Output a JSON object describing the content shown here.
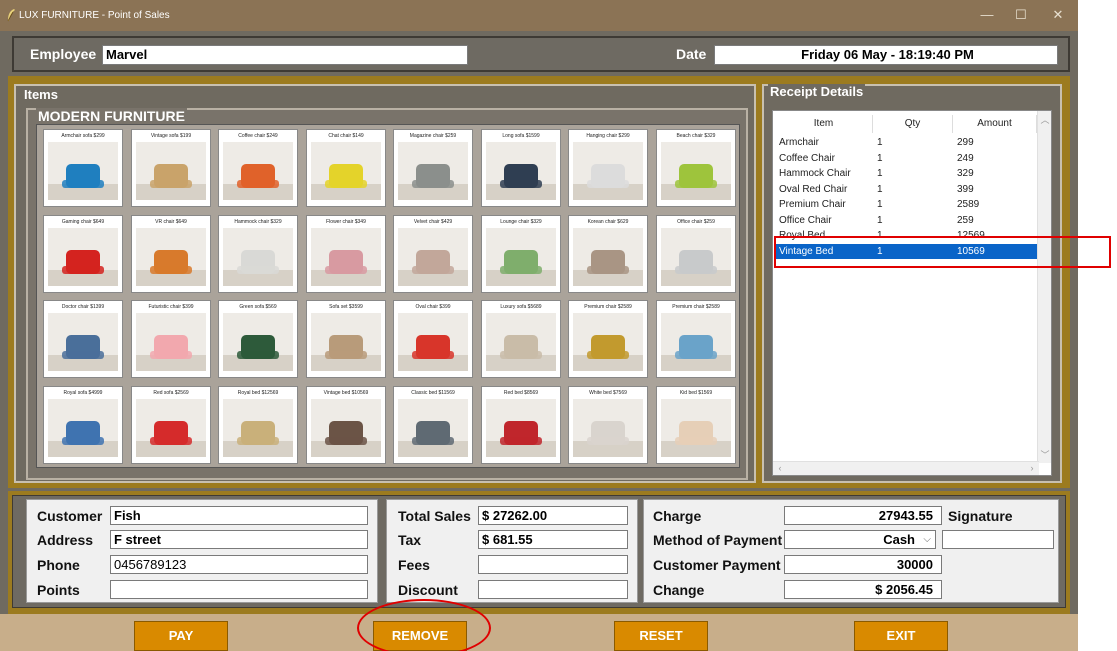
{
  "window": {
    "title": "LUX FURNITURE - Point of Sales",
    "controls": {
      "minimize": "—",
      "maximize": "☐",
      "close": "✕"
    }
  },
  "header": {
    "employee_label": "Employee",
    "employee_value": "Marvel",
    "date_label": "Date",
    "date_value": "Friday 06 May - 18:19:40 PM"
  },
  "items_panel": {
    "legend": "Items",
    "section_legend": "MODERN FURNITURE",
    "products": [
      {
        "caption": "Armchair sofa  $299",
        "color": "#1f7fbf"
      },
      {
        "caption": "Vintage sofa  $199",
        "color": "#c9a36a"
      },
      {
        "caption": "Coffee chair  $249",
        "color": "#e0622a"
      },
      {
        "caption": "Chat chair  $149",
        "color": "#e4d32a"
      },
      {
        "caption": "Magazine chair  $259",
        "color": "#8b8f8c"
      },
      {
        "caption": "Long sofa  $1599",
        "color": "#2f3e52"
      },
      {
        "caption": "Hanging chair  $299",
        "color": "#dcdcdc"
      },
      {
        "caption": "Beach chair  $329",
        "color": "#9ec43c"
      },
      {
        "caption": "Gaming chair  $649",
        "color": "#d4231f"
      },
      {
        "caption": "VR chair  $649",
        "color": "#d87a2c"
      },
      {
        "caption": "Hammock chair  $329",
        "color": "#d9d9d6"
      },
      {
        "caption": "Flower chair  $349",
        "color": "#d89aa1"
      },
      {
        "caption": "Velvet chair  $429",
        "color": "#c2a79a"
      },
      {
        "caption": "Lounge chair  $329",
        "color": "#7fae6c"
      },
      {
        "caption": "Korean chair  $629",
        "color": "#a99584"
      },
      {
        "caption": "Office chair  $259",
        "color": "#c8cacb"
      },
      {
        "caption": "Doctor chair  $1399",
        "color": "#4a6f9a"
      },
      {
        "caption": "Futuristic chair  $399",
        "color": "#f2a8ae"
      },
      {
        "caption": "Green sofa  $569",
        "color": "#2d5a3a"
      },
      {
        "caption": "Sofa set  $3599",
        "color": "#b89b7a"
      },
      {
        "caption": "Oval chair  $399",
        "color": "#d8352a"
      },
      {
        "caption": "Luxury sofa  $5689",
        "color": "#c9bca8"
      },
      {
        "caption": "Premium chair  $2589",
        "color": "#c29a2e"
      },
      {
        "caption": "Premium chair  $2589",
        "color": "#6aa3c9"
      },
      {
        "caption": "Royal sofa  $4999",
        "color": "#3f73b0"
      },
      {
        "caption": "Red sofa  $2569",
        "color": "#d52b2b"
      },
      {
        "caption": "Royal bed  $12569",
        "color": "#c9b07a"
      },
      {
        "caption": "Vintage bed  $10569",
        "color": "#6b5446"
      },
      {
        "caption": "Classic bed  $11569",
        "color": "#5f6a73"
      },
      {
        "caption": "Red bed  $8569",
        "color": "#c0262c"
      },
      {
        "caption": "White bed  $7569",
        "color": "#d9d4ce"
      },
      {
        "caption": "Kid bed  $1569",
        "color": "#e6cfb7"
      }
    ]
  },
  "receipt": {
    "legend": "Receipt Details",
    "columns": [
      "Item",
      "Qty",
      "Amount"
    ],
    "rows": [
      {
        "item": "Armchair",
        "qty": "1",
        "amount": "299"
      },
      {
        "item": "Coffee Chair",
        "qty": "1",
        "amount": "249"
      },
      {
        "item": "Hammock Chair",
        "qty": "1",
        "amount": "329"
      },
      {
        "item": "Oval Red Chair",
        "qty": "1",
        "amount": "399"
      },
      {
        "item": "Premium Chair",
        "qty": "1",
        "amount": "2589"
      },
      {
        "item": "Office Chair",
        "qty": "1",
        "amount": "259"
      },
      {
        "item": "Royal Bed",
        "qty": "1",
        "amount": "12569"
      },
      {
        "item": "Vintage Bed",
        "qty": "1",
        "amount": "10569"
      }
    ],
    "selected_row": "Vintage Bed"
  },
  "customer": {
    "customer_label": "Customer",
    "customer_value": "Fish",
    "address_label": "Address",
    "address_value": "F street",
    "phone_label": "Phone",
    "phone_value": "0456789123",
    "points_label": "Points",
    "points_value": ""
  },
  "totals": {
    "total_sales_label": "Total Sales",
    "total_sales_value": "$ 27262.00",
    "tax_label": "Tax",
    "tax_value": "$ 681.55",
    "fees_label": "Fees",
    "fees_value": "",
    "discount_label": "Discount",
    "discount_value": ""
  },
  "payment": {
    "charge_label": "Charge",
    "charge_value": "27943.55",
    "signature_label": "Signature",
    "signature_value": "",
    "method_label": "Method of Payment",
    "method_value": "Cash",
    "customer_payment_label": "Customer Payment",
    "customer_payment_value": "30000",
    "change_label": "Change",
    "change_value": "$ 2056.45"
  },
  "buttons": {
    "pay": "PAY",
    "remove": "REMOVE",
    "reset": "RESET",
    "exit": "EXIT"
  },
  "colors": {
    "frame_gold": "#9c7b1f",
    "panel_grey": "#6f6a60",
    "button_orange": "#d98a00",
    "selection_blue": "#0a64c8",
    "highlight_red": "#e00000"
  }
}
